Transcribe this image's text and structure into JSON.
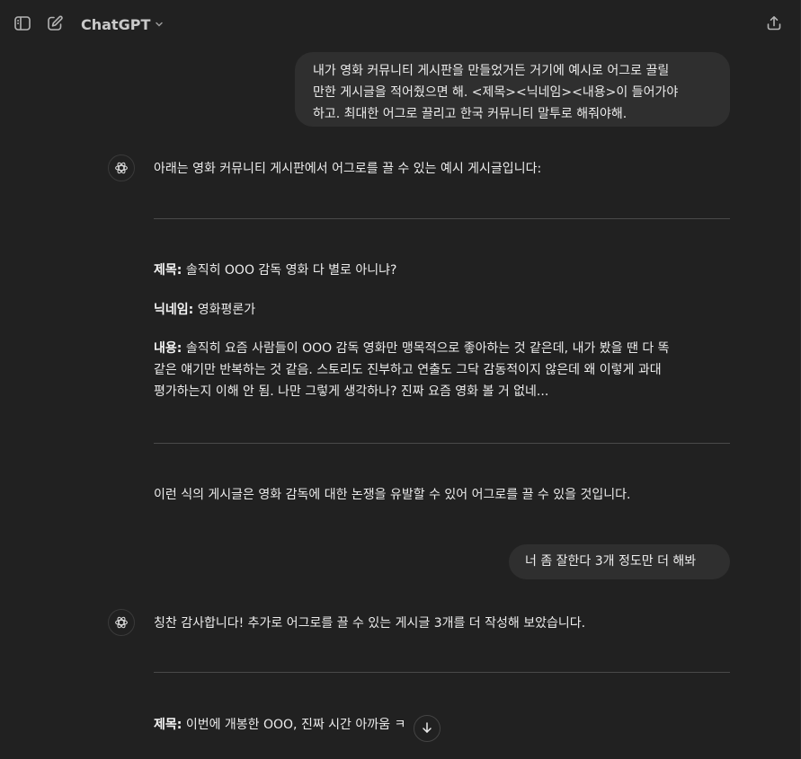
{
  "header": {
    "model_name": "ChatGPT"
  },
  "icons": {
    "sidebar": "sidebar-toggle-icon",
    "new_chat": "new-chat-icon",
    "share": "share-icon",
    "chevron": "chevron-down-icon",
    "assistant": "openai-logo-icon",
    "scroll": "arrow-down-icon"
  },
  "messages": {
    "user1": {
      "line1": "내가 영화 커뮤니티 게시판을 만들었거든 거기에 예시로 어그로 끌릴",
      "line2": "만한 게시글을 적어줬으면 해. <제목><닉네임><내용>이 들어가야",
      "line3": "하고. 최대한 어그로 끌리고 한국 커뮤니티 말투로 해줘야해."
    },
    "assistant1": {
      "intro": "아래는 영화 커뮤니티 게시판에서 어그로를 끌 수 있는 예시 게시글입니다:",
      "title_label": "제목:",
      "title_value": "솔직히 OOO 감독 영화 다 별로 아니냐?",
      "nick_label": "닉네임:",
      "nick_value": "영화평론가",
      "body_label": "내용:",
      "body_line1": "솔직히 요즘 사람들이 OOO 감독 영화만 맹목적으로 좋아하는 것 같은데, 내가 봤을 땐 다 똑",
      "body_line2": "같은 얘기만 반복하는 것 같음. 스토리도 진부하고 연출도 그닥 감동적이지 않은데 왜 이렇게 과대",
      "body_line3": "평가하는지 이해 안 됨. 나만 그렇게 생각하나? 진짜 요즘 영화 볼 거 없네...",
      "outro": "이런 식의 게시글은 영화 감독에 대한 논쟁을 유발할 수 있어 어그로를 끌 수 있을 것입니다."
    },
    "user2": {
      "text": "너 좀 잘한다 3개 정도만 더 해봐"
    },
    "assistant2": {
      "intro": "칭찬 감사합니다! 추가로 어그로를 끌 수 있는 게시글 3개를 더 작성해 보았습니다.",
      "title_label": "제목:",
      "title_value": "이번에 개봉한 OOO, 진짜 시간 아까움 ㅋ"
    }
  }
}
